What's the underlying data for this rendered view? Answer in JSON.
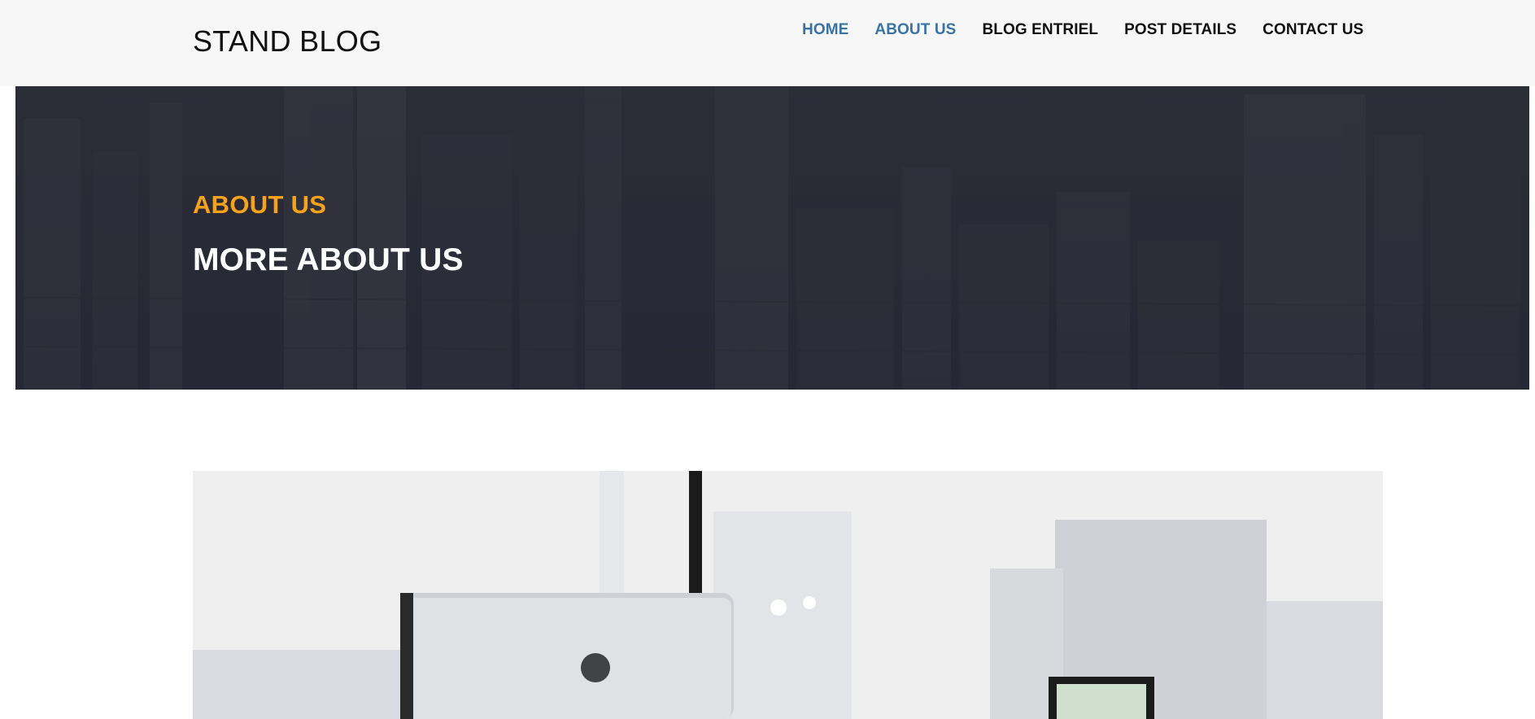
{
  "header": {
    "brand": "STAND BLOG",
    "nav": [
      {
        "label": "HOME",
        "active": true
      },
      {
        "label": "ABOUT US",
        "active": true
      },
      {
        "label": "BLOG ENTRIEL",
        "active": false
      },
      {
        "label": "POST DETAILS",
        "active": false
      },
      {
        "label": "CONTACT US",
        "active": false
      }
    ]
  },
  "hero": {
    "subtitle": "ABOUT US",
    "title": "MORE ABOUT US"
  },
  "colors": {
    "accent_orange": "#f7a21b",
    "nav_active": "#3a74a6",
    "header_bg": "#f7f7f7",
    "hero_overlay": "#2a2b36"
  }
}
